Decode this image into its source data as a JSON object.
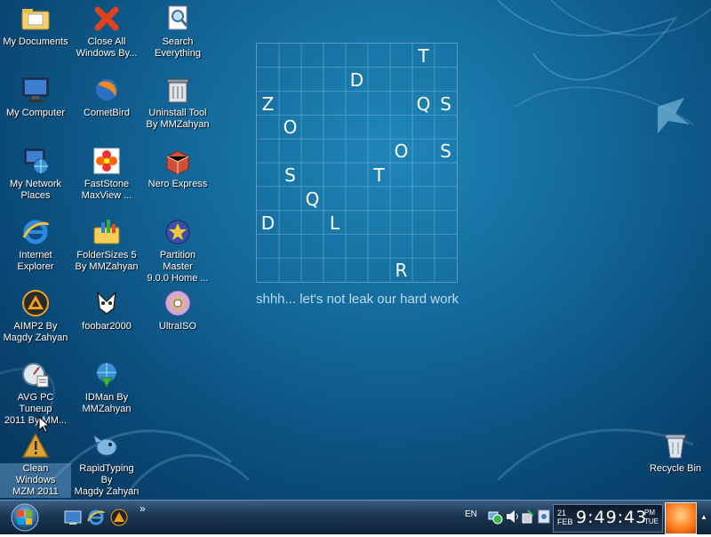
{
  "desktop": {
    "icons": [
      {
        "label": "My Documents",
        "icon": "folder-documents-icon"
      },
      {
        "label": "Close All\nWindows By...",
        "icon": "red-x-icon"
      },
      {
        "label": "Search\nEverything",
        "icon": "magnifier-document-icon"
      },
      {
        "label": "My Computer",
        "icon": "monitor-icon"
      },
      {
        "label": "CometBird",
        "icon": "browser-globe-icon"
      },
      {
        "label": "Uninstall Tool\nBy MMZahyan",
        "icon": "trash-can-icon"
      },
      {
        "label": "My Network\nPlaces",
        "icon": "network-globe-icon"
      },
      {
        "label": "FastStone\nMaxView ...",
        "icon": "flower-viewer-icon"
      },
      {
        "label": "Nero Express",
        "icon": "nero-box-icon"
      },
      {
        "label": "Internet\nExplorer",
        "icon": "ie-logo-icon"
      },
      {
        "label": "FolderSizes 5\nBy MMZahyan",
        "icon": "folder-chart-icon"
      },
      {
        "label": "Partition Master\n9.0.0 Home ...",
        "icon": "partition-star-icon"
      },
      {
        "label": "AIMP2 By\nMagdy Zahyan",
        "icon": "aimp-triangle-icon"
      },
      {
        "label": "foobar2000",
        "icon": "foobar-logo-icon"
      },
      {
        "label": "UltraISO",
        "icon": "disc-icon"
      },
      {
        "label": "AVG PC Tuneup\n2011 By MM...",
        "icon": "gauge-icon"
      },
      {
        "label": "IDMan By\nMMZahyan",
        "icon": "globe-arrow-icon"
      },
      {
        "label": "Clean Windows\nMZM 2011",
        "icon": "warning-triangle-icon"
      },
      {
        "label": "RapidTyping By\nMagdy Zahyan",
        "icon": "fish-icon"
      },
      {
        "label": "Recycle Bin",
        "icon": "recycle-bin-icon"
      }
    ],
    "puzzle": {
      "grid_color": "#9fd2f0",
      "letters": [
        {
          "char": "T",
          "row": 0,
          "col": 7
        },
        {
          "char": "D",
          "row": 1,
          "col": 4
        },
        {
          "char": "Z",
          "row": 2,
          "col": 0
        },
        {
          "char": "Q",
          "row": 2,
          "col": 7
        },
        {
          "char": "S",
          "row": 2,
          "col": 8
        },
        {
          "char": "O",
          "row": 3,
          "col": 1
        },
        {
          "char": "O",
          "row": 4,
          "col": 6
        },
        {
          "char": "S",
          "row": 4,
          "col": 8
        },
        {
          "char": "S",
          "row": 5,
          "col": 1
        },
        {
          "char": "T",
          "row": 5,
          "col": 5
        },
        {
          "char": "Q",
          "row": 6,
          "col": 2
        },
        {
          "char": "D",
          "row": 7,
          "col": 0
        },
        {
          "char": "L",
          "row": 7,
          "col": 3
        },
        {
          "char": "R",
          "row": 9,
          "col": 6
        }
      ],
      "rows": 10,
      "cols": 9
    },
    "caption": "shhh... let's not leak our hard work"
  },
  "taskbar": {
    "start_icon": "windows-orb-icon",
    "quick_launch": [
      "show-desktop-icon",
      "ie-logo-icon",
      "aimp-icon"
    ],
    "chevron": "»",
    "tray": {
      "language": "EN",
      "icons": [
        "network-icon",
        "volume-icon",
        "safely-remove-icon",
        "security-icon"
      ]
    },
    "clock": {
      "day": "21",
      "month": "FEB",
      "time": "9:49:43",
      "ampm": "PM",
      "weekday": "TUE"
    }
  },
  "colors": {
    "desktop_bg": "#146a9c",
    "taskbar_bg": "#1a3553",
    "accent": "#ff7b1c"
  }
}
